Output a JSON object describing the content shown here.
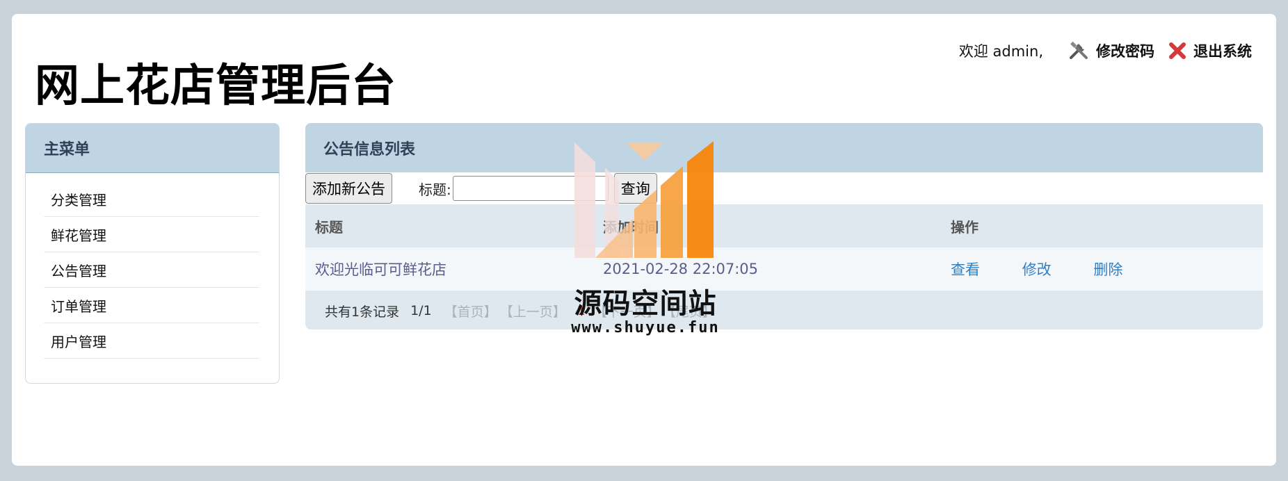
{
  "site_title": "网上花店管理后台",
  "topbar": {
    "welcome": "欢迎 admin,",
    "change_password": "修改密码",
    "logout": "退出系统"
  },
  "sidebar": {
    "title": "主菜单",
    "items": [
      "分类管理",
      "鲜花管理",
      "公告管理",
      "订单管理",
      "用户管理"
    ]
  },
  "main": {
    "title": "公告信息列表",
    "add_button": "添加新公告",
    "search_label": "标题:",
    "search_value": "",
    "query_button": "查询",
    "columns": [
      "标题",
      "添加时间",
      "操作"
    ],
    "rows": [
      {
        "title": "欢迎光临可可鲜花店",
        "time": "2021-02-28 22:07:05",
        "view": "查看",
        "edit": "修改",
        "delete": "删除"
      }
    ],
    "pager": {
      "total": "共有1条记录",
      "page": "1/1",
      "first": "【首页】",
      "prev": "【上一页】",
      "current": "1",
      "next": "【下一页】",
      "last": "【尾页】"
    }
  },
  "watermark": {
    "name": "源码空间站",
    "url": "www.shuyue.fun"
  },
  "colors": {
    "panel_header": "#bfd5e4",
    "link": "#2f7fc4",
    "watermark_orange": "#f7860a"
  }
}
